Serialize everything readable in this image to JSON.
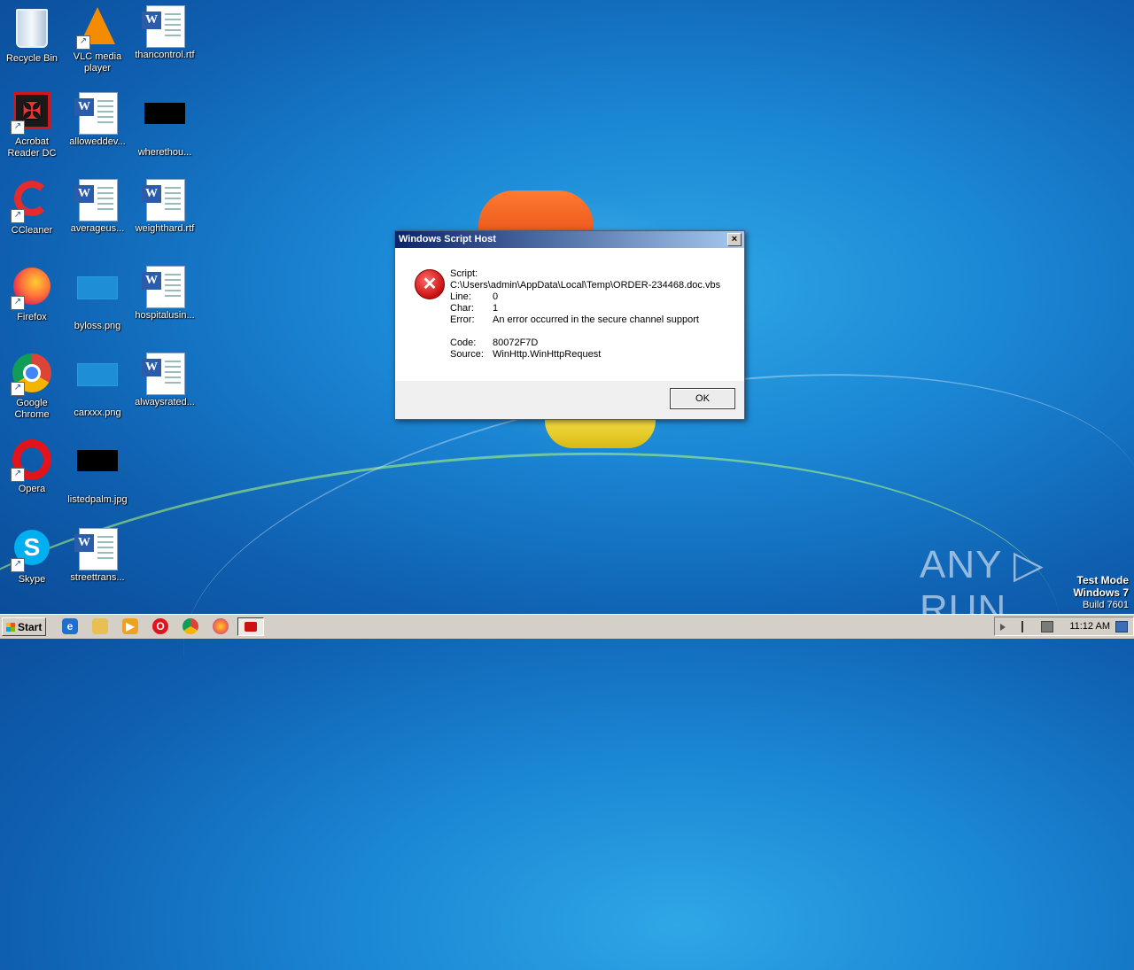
{
  "desktop": {
    "icons": [
      {
        "label": "Recycle Bin",
        "icon": "recycle-bin-icon"
      },
      {
        "label": "VLC media player",
        "icon": "vlc-icon"
      },
      {
        "label": "thancontrol.rtf",
        "icon": "word-document-icon"
      },
      {
        "label": "Acrobat Reader DC",
        "icon": "acrobat-icon"
      },
      {
        "label": "alloweddev...",
        "icon": "word-document-icon"
      },
      {
        "label": "wherethou...",
        "icon": "black-image-icon"
      },
      {
        "label": "CCleaner",
        "icon": "ccleaner-icon"
      },
      {
        "label": "averageus...",
        "icon": "word-document-icon"
      },
      {
        "label": "weighthard.rtf",
        "icon": "word-document-icon"
      },
      {
        "label": "Firefox",
        "icon": "firefox-icon"
      },
      {
        "label": "byloss.png",
        "icon": "image-icon"
      },
      {
        "label": "hospitalusin...",
        "icon": "word-document-icon"
      },
      {
        "label": "Google Chrome",
        "icon": "chrome-icon"
      },
      {
        "label": "carxxx.png",
        "icon": "image-icon"
      },
      {
        "label": "alwaysrated...",
        "icon": "word-document-icon"
      },
      {
        "label": "Opera",
        "icon": "opera-icon"
      },
      {
        "label": "listedpalm.jpg",
        "icon": "black-image-icon"
      },
      {
        "label": "Skype",
        "icon": "skype-icon"
      },
      {
        "label": "streettrans...",
        "icon": "word-document-icon"
      }
    ]
  },
  "dialog": {
    "title": "Windows Script Host",
    "close_glyph": "×",
    "error_glyph": "✕",
    "script_label": "Script:",
    "script_path": "C:\\Users\\admin\\AppData\\Local\\Temp\\ORDER-234468.doc.vbs",
    "line_label": "Line:",
    "line_value": "0",
    "char_label": "Char:",
    "char_value": "1",
    "error_label": "Error:",
    "error_value": "An error occurred in the secure channel support",
    "code_label": "Code:",
    "code_value": "80072F7D",
    "source_label": "Source:",
    "source_value": "WinHttp.WinHttpRequest",
    "ok_label": "OK"
  },
  "watermark": "ANY ▷ RUN",
  "test_mode": {
    "line1": "Test Mode",
    "line2": "Windows 7",
    "line3": "Build 7601"
  },
  "taskbar": {
    "start_label": "Start",
    "clock": "11:12 AM"
  }
}
